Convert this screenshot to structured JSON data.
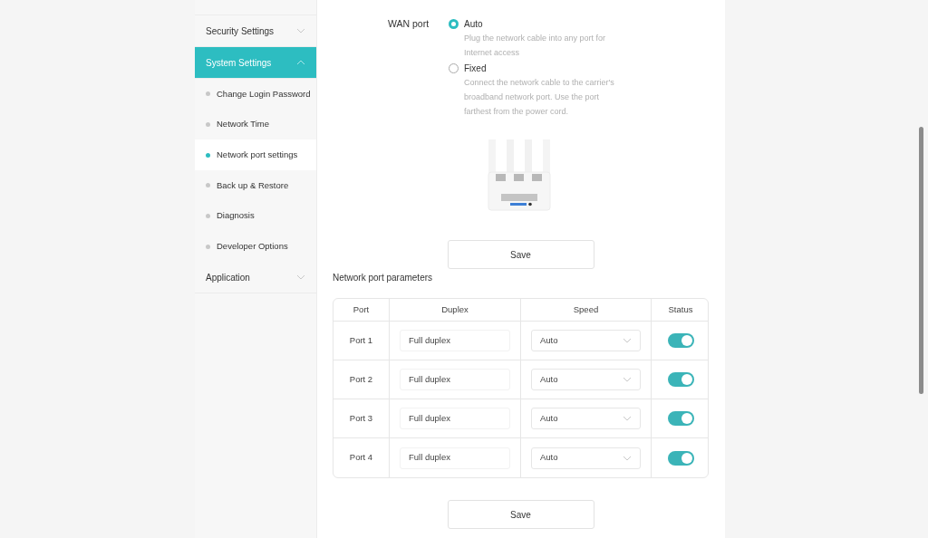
{
  "sidebar": {
    "items": [
      {
        "label": "Security Settings",
        "expanded": false,
        "selected": false
      },
      {
        "label": "System Settings",
        "expanded": true,
        "selected": true,
        "children": [
          {
            "label": "Change Login Password",
            "selected": false
          },
          {
            "label": "Network Time",
            "selected": false
          },
          {
            "label": "Network port settings",
            "selected": true
          },
          {
            "label": "Back up & Restore",
            "selected": false
          },
          {
            "label": "Diagnosis",
            "selected": false
          },
          {
            "label": "Developer Options",
            "selected": false
          }
        ]
      },
      {
        "label": "Application",
        "expanded": false,
        "selected": false
      }
    ]
  },
  "wan_port": {
    "label": "WAN port",
    "options": [
      {
        "label": "Auto",
        "selected": true,
        "description": "Plug the network cable into any port for Internet access"
      },
      {
        "label": "Fixed",
        "selected": false,
        "description": "Connect the network cable to the carrier's broadband network port. Use the port farthest from the power cord."
      }
    ]
  },
  "save_button": "Save",
  "port_table": {
    "title": "Network port parameters",
    "columns": [
      "Port",
      "Duplex",
      "Speed",
      "Status"
    ],
    "rows": [
      {
        "port": "Port 1",
        "duplex": "Full duplex",
        "speed": "Auto",
        "on": true
      },
      {
        "port": "Port 2",
        "duplex": "Full duplex",
        "speed": "Auto",
        "on": true
      },
      {
        "port": "Port 3",
        "duplex": "Full duplex",
        "speed": "Auto",
        "on": true
      },
      {
        "port": "Port 4",
        "duplex": "Full duplex",
        "speed": "Auto",
        "on": true
      }
    ]
  },
  "save_button_bottom": "Save"
}
